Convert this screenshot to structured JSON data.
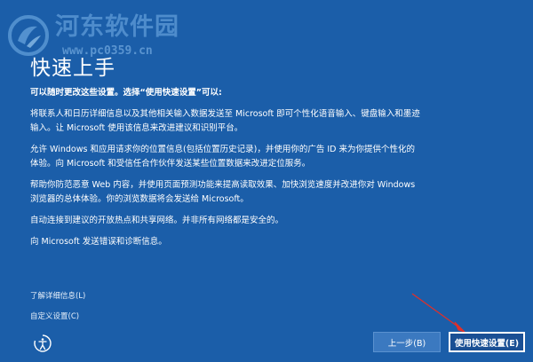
{
  "watermark": {
    "site_name": "河东软件园",
    "url": "www.pc0359.cn"
  },
  "page": {
    "title": "快速上手"
  },
  "content": {
    "lead": "可以随时更改这些设置。选择“使用快速设置”可以:",
    "paragraphs": [
      "将联系人和日历详细信息以及其他相关输入数据发送至 Microsoft 即可个性化语音输入、键盘输入和墨迹输入。让 Microsoft 使用该信息来改进建议和识别平台。",
      "允许 Windows 和应用请求你的位置信息(包括位置历史记录)，并使用你的广告 ID 来为你提供个性化的体验。向 Microsoft 和受信任合作伙伴发送某些位置数据来改进定位服务。",
      "帮助你防范恶意 Web 内容，并使用页面预测功能来提高读取效果、加快浏览速度并改进你对 Windows 浏览器的总体体验。你的浏览数据将会发送给 Microsoft。",
      "自动连接到建议的开放热点和共享网络。并非所有网络都是安全的。",
      "向 Microsoft 发送错误和诊断信息。"
    ]
  },
  "links": {
    "learn_more": "了解详细信息(L)",
    "customize": "自定义设置(C)"
  },
  "buttons": {
    "back": "上一步(B)",
    "express": "使用快速设置(E)"
  },
  "icons": {
    "ease_of_access": "ease-of-access-icon",
    "watermark_logo": "watermark-logo-icon",
    "annotation_arrow": "red-arrow"
  },
  "colors": {
    "background": "#1b5ea9",
    "button_back": "#3b79c0",
    "button_primary": "#1a4f94",
    "annotation": "#e0302a",
    "watermark": "#5d9ad6"
  }
}
